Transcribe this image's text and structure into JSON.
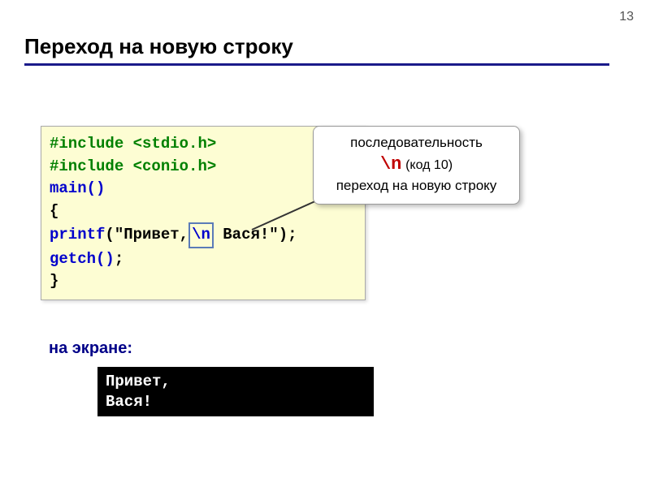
{
  "page_number": "13",
  "title": "Переход на новую строку",
  "code": {
    "include1_kw": "#include ",
    "include1_lib": "<stdio.h>",
    "include2_kw": "#include ",
    "include2_lib": "<conio.h>",
    "main": "main()",
    "brace_open": "{",
    "printf_fn": "printf",
    "printf_open": "(\"",
    "printf_text1": "Привет,",
    "newline_symbol": "\\n",
    "printf_text2": " Вася!",
    "printf_close": "\")",
    "semicolon": ";",
    "getch_fn": "getch",
    "getch_parens": "()",
    "brace_close": "}"
  },
  "callout": {
    "line1": "последовательность",
    "symbol": "\\n",
    "code10": "(код 10)",
    "line3": "переход на новую строку"
  },
  "screen_label": "на экране:",
  "output": {
    "line1": "Привет,",
    "line2": "Вася!"
  }
}
